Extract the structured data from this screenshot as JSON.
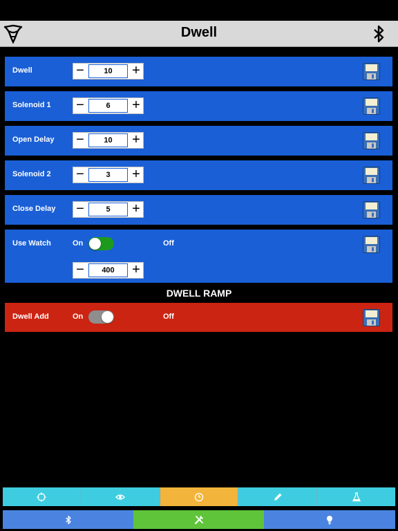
{
  "header": {
    "title": "Dwell"
  },
  "rows": [
    {
      "label": "Dwell",
      "value": "10"
    },
    {
      "label": "Solenoid 1",
      "value": "6"
    },
    {
      "label": "Open Delay",
      "value": "10"
    },
    {
      "label": "Solenoid 2",
      "value": "3"
    },
    {
      "label": "Close Delay",
      "value": "5"
    }
  ],
  "use_watch": {
    "label": "Use Watch",
    "on": "On",
    "off": "Off",
    "value": "400",
    "toggle_state": "on"
  },
  "section": {
    "title": "DWELL RAMP"
  },
  "dwell_add": {
    "label": "Dwell Add",
    "on": "On",
    "off": "Off",
    "toggle_state": "off"
  },
  "stepper": {
    "minus": "−",
    "plus": "+"
  },
  "colors": {
    "row_blue": "#1a5fd6",
    "row_red": "#cc2412",
    "toggle_on": "#1d9a1d",
    "toggle_off": "#8e8e8e",
    "tab_cyan": "#3ecde0",
    "tab_active_orange": "#f2b43a",
    "bottom_blue": "#4a84e0",
    "bottom_green": "#5fc43a"
  },
  "tabs_top": [
    {
      "icon": "crosshair-icon"
    },
    {
      "icon": "eye-icon"
    },
    {
      "icon": "clock-icon",
      "active": true
    },
    {
      "icon": "pencil-icon"
    },
    {
      "icon": "flask-icon"
    }
  ],
  "tabs_bottom": [
    {
      "icon": "bluetooth-icon"
    },
    {
      "icon": "tools-icon",
      "active": true
    },
    {
      "icon": "lightbulb-icon"
    }
  ]
}
